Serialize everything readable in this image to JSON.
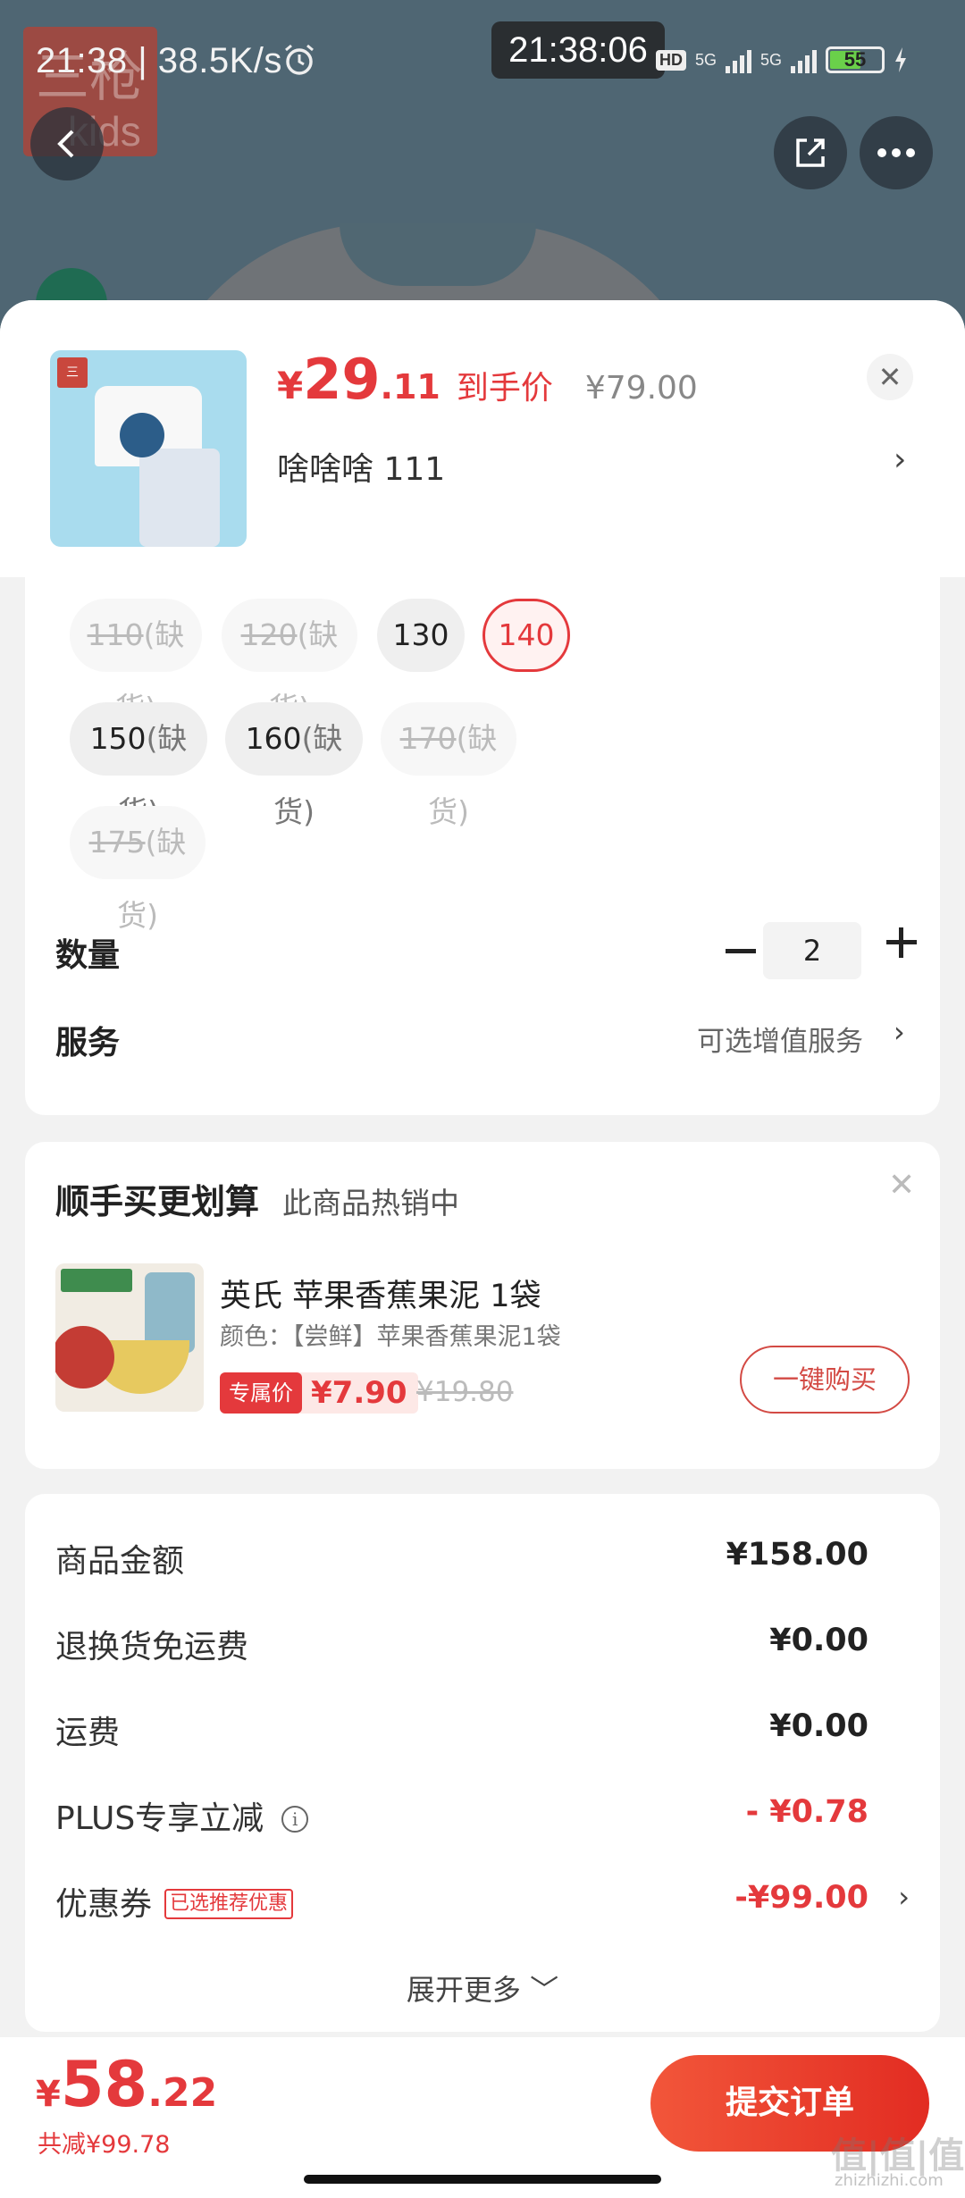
{
  "status_bar": {
    "time_left": "21:38 | 38.5K/s",
    "clock": "21:38:06",
    "hd": "HD",
    "net1": "5G",
    "net2": "5G",
    "battery": "55"
  },
  "background": {
    "brand_logo_line1": "三枪",
    "brand_logo_line2": "kids"
  },
  "product": {
    "price_symbol": "¥",
    "price_int": "29",
    "price_dec": ".11",
    "price_label": "到手价",
    "original_price": "¥79.00",
    "variant": "啥啥啥  111"
  },
  "sizes": [
    {
      "size": "110",
      "note": "(缺货)",
      "state": "disabled"
    },
    {
      "size": "120",
      "note": "(缺货)",
      "state": "disabled"
    },
    {
      "size": "130",
      "note": "",
      "state": "normal"
    },
    {
      "size": "140",
      "note": "",
      "state": "selected"
    },
    {
      "size": "150",
      "note": "(缺货)",
      "state": "normal"
    },
    {
      "size": "160",
      "note": "(缺货)",
      "state": "normal"
    },
    {
      "size": "170",
      "note": "(缺货)",
      "state": "disabled"
    },
    {
      "size": "175",
      "note": "(缺货)",
      "state": "disabled"
    }
  ],
  "quantity": {
    "label": "数量",
    "value": "2"
  },
  "service": {
    "label": "服务",
    "hint": "可选增值服务"
  },
  "bundle": {
    "title": "顺手买更划算",
    "subtitle": "此商品热销中",
    "item_name": "英氏 苹果香蕉果泥 1袋",
    "item_color": "颜色：【尝鲜】苹果香蕉果泥1袋",
    "special_label": "专属价",
    "special_price": "¥7.90",
    "original_price": "¥19.80",
    "buy_button": "一键购买"
  },
  "summary": {
    "rows": [
      {
        "label": "商品金额",
        "value": "¥158.00"
      },
      {
        "label": "退换货免运费",
        "value": "¥0.00"
      },
      {
        "label": "运费",
        "value": "¥0.00"
      },
      {
        "label": "PLUS专享立减",
        "value": "- ¥0.78"
      },
      {
        "label": "优惠券",
        "value": "-¥99.00"
      }
    ],
    "coupon_tag": "已选推荐优惠",
    "expand": "展开更多 ﹀"
  },
  "footer": {
    "total_symbol": "¥",
    "total_int": "58",
    "total_dec": ".22",
    "saved": "共减¥99.78",
    "submit": "提交订单"
  },
  "watermark": {
    "main": "值|值|值",
    "site": "zhizhizhi.com"
  },
  "colors": {
    "accent": "#e4393c",
    "background": "#f2f2f2"
  }
}
